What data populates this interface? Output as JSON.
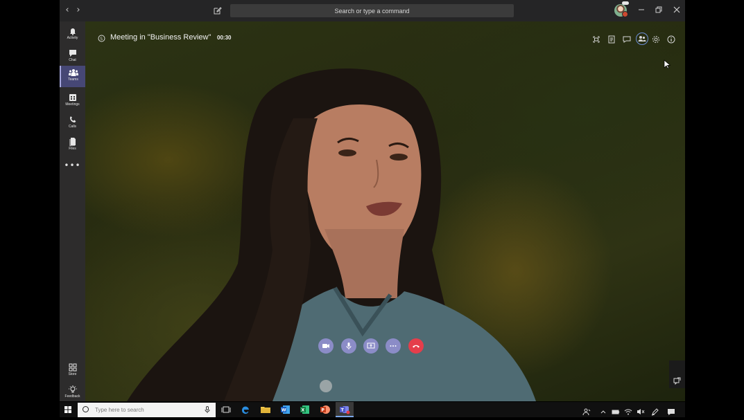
{
  "titlebar": {
    "search_placeholder": "Search or type a command"
  },
  "rail": {
    "items": [
      {
        "label": "Activity",
        "icon": "bell-icon"
      },
      {
        "label": "Chat",
        "icon": "chat-icon"
      },
      {
        "label": "Teams",
        "icon": "teams-icon",
        "active": true
      },
      {
        "label": "Meetings",
        "icon": "calendar-icon"
      },
      {
        "label": "Calls",
        "icon": "phone-icon"
      },
      {
        "label": "Files",
        "icon": "files-icon"
      }
    ],
    "more": "•••",
    "bottom": [
      {
        "label": "Store",
        "icon": "store-icon"
      },
      {
        "label": "Feedback",
        "icon": "feedback-icon"
      }
    ]
  },
  "meeting": {
    "title": "Meeting in \"Business Review\"",
    "timer": "00:30"
  },
  "taskbar": {
    "search_placeholder": "Type here to search"
  },
  "colors": {
    "accent": "#8b8cc7",
    "hangup": "#e53e4b",
    "rail_active": "#464775",
    "titlebar": "#252526",
    "rail": "#2d2c2c"
  }
}
